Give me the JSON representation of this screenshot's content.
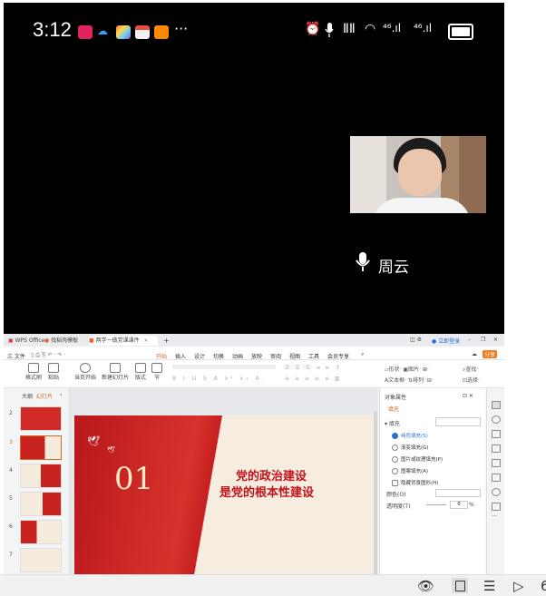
{
  "status_bar": {
    "time": "3:12",
    "more": "···",
    "network_1": "⁴⁶.ıl",
    "network_2": "⁴⁶.ıl"
  },
  "call": {
    "speaker_name": "周云"
  },
  "wps": {
    "tabs": [
      {
        "label": "WPS Office"
      },
      {
        "label": "找稻壳模板"
      },
      {
        "label": "两学一做党课课件"
      }
    ],
    "user_label": "立即登录",
    "share_label": "分享",
    "menu_file": "三 文件",
    "menu": [
      "开始",
      "插入",
      "设计",
      "切换",
      "动画",
      "放映",
      "审阅",
      "视图",
      "工具",
      "会员专享"
    ],
    "toolbar": [
      {
        "label": "格式刷"
      },
      {
        "label": "粘贴"
      },
      {
        "label": "当页开始"
      },
      {
        "label": "新建幻灯片"
      },
      {
        "label": "版式"
      },
      {
        "label": "节"
      }
    ],
    "panel_tabs": [
      "大纲",
      "幻灯片"
    ],
    "slide_numbers": [
      "2",
      "3",
      "4",
      "5",
      "6",
      "7"
    ],
    "slide": {
      "number": "01",
      "title_line1": "党的政治建设",
      "title_line2": "是党的根本性建设"
    },
    "properties": {
      "title": "对象属性",
      "tab": "填充",
      "section": "填充",
      "options": [
        "纯色填充(S)",
        "渐变填充(G)",
        "图片或纹理填充(P)",
        "图案填充(A)",
        "隐藏背景图形(H)"
      ],
      "color_label": "颜色(O)",
      "transparency_label": "透明度(T)",
      "transparency_value": "0",
      "transparency_unit": "%"
    }
  }
}
